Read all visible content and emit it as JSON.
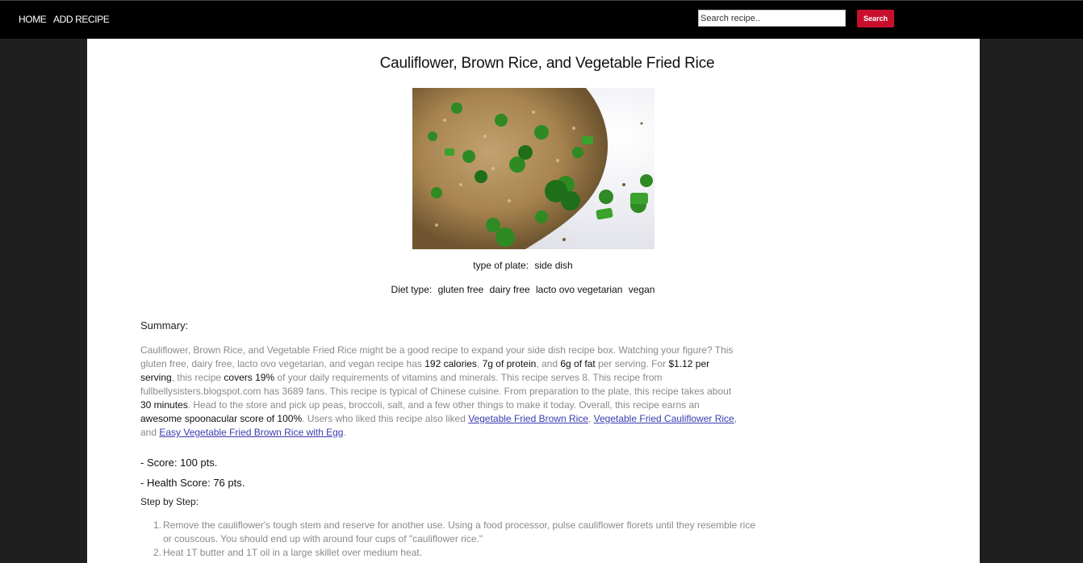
{
  "nav": {
    "home": "HOME",
    "add_recipe": "ADD RECIPE",
    "search_placeholder": "Search recipe..",
    "search_button": "Search"
  },
  "recipe": {
    "title": "Cauliflower, Brown Rice, and Vegetable Fried Rice",
    "plate_label": "type of plate:",
    "plate_value": "side dish",
    "diet_label": "Diet type:",
    "diets": [
      "gluten free",
      "dairy free",
      "lacto ovo vegetarian",
      "vegan"
    ],
    "summary_label": "Summary:",
    "summary": {
      "t1": "Cauliflower, Brown Rice, and Vegetable Fried Rice might be a good recipe to expand your side dish recipe box. Watching your figure? This gluten free, dairy free, lacto ovo vegetarian, and vegan recipe has ",
      "b1": "192 calories",
      "t2": ", ",
      "b2": "7g of protein",
      "t3": ", and ",
      "b3": "6g of fat",
      "t4": " per serving. For ",
      "b4": "$1.12 per serving",
      "t5": ", this recipe ",
      "b5": "covers 19%",
      "t6": " of your daily requirements of vitamins and minerals. This recipe serves 8. This recipe from fullbellysisters.blogspot.com has 3689 fans. This recipe is typical of Chinese cuisine. From preparation to the plate, this recipe takes about ",
      "b6": "30 minutes",
      "t7": ". Head to the store and pick up peas, broccoli, salt, and a few other things to make it today. Overall, this recipe earns an ",
      "b7": "awesome spoonacular score of 100%",
      "t8": ". Users who liked this recipe also liked ",
      "l1": "Vegetable Fried Brown Rice",
      "t9": ", ",
      "l2": "Vegetable Fried Cauliflower Rice",
      "t10": ", and ",
      "l3": "Easy Vegetable Fried Brown Rice with Egg",
      "t11": "."
    },
    "score": "- Score: 100 pts.",
    "health_score": "- Health Score: 76 pts.",
    "steps_label": "Step by Step:",
    "steps": [
      {
        "num": "1.",
        "text": "Remove the cauliflower's tough stem and reserve for another use. Using a food processor, pulse cauliflower florets until they resemble rice or couscous. You should end up with around four cups of \"cauliflower rice.\""
      },
      {
        "num": "2.",
        "text": "Heat 1T butter and 1T oil in a large skillet over medium heat."
      }
    ]
  },
  "colors": {
    "topbar": "#000000",
    "search_button": "#c8102e",
    "link": "#3b3bb0",
    "page_bg": "#1f1f1f"
  }
}
